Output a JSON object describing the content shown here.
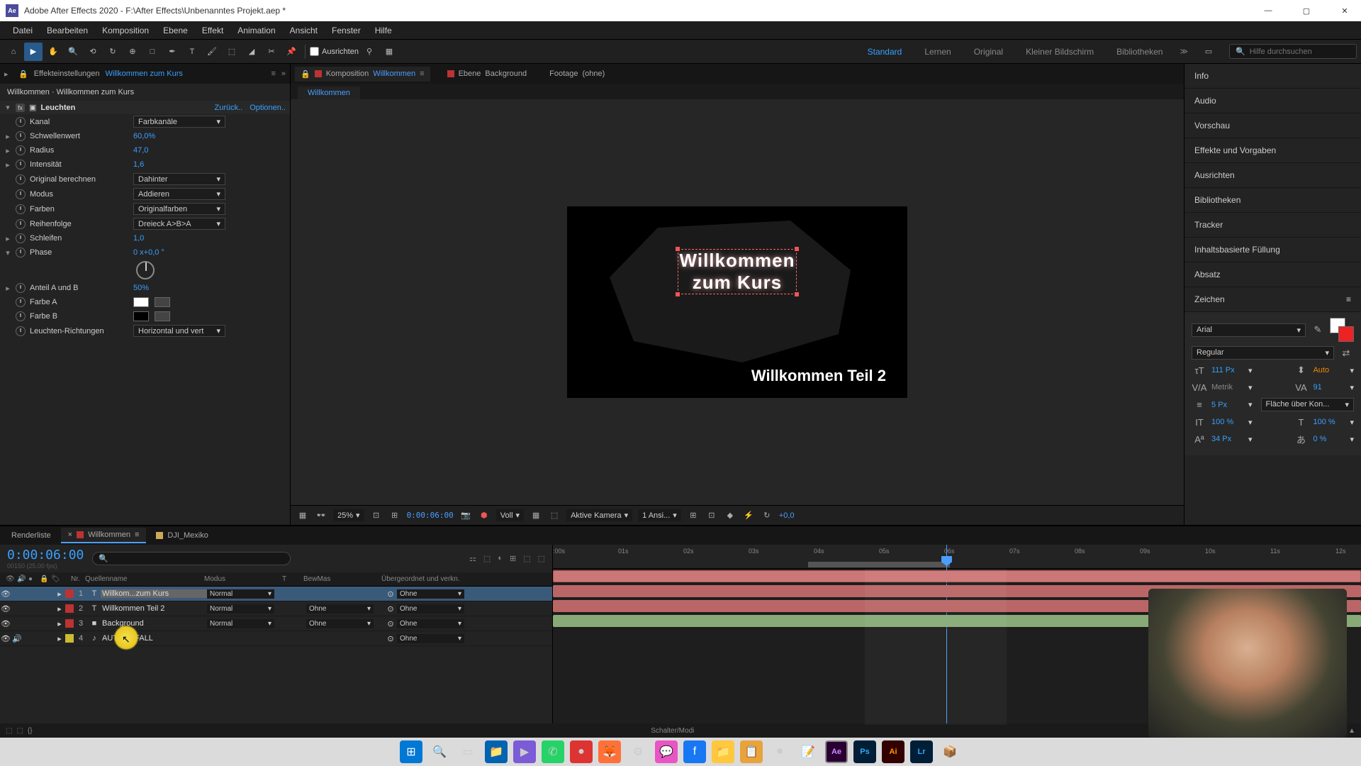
{
  "title": "Adobe After Effects 2020 - F:\\After Effects\\Unbenanntes Projekt.aep *",
  "menu": [
    "Datei",
    "Bearbeiten",
    "Komposition",
    "Ebene",
    "Effekt",
    "Animation",
    "Ansicht",
    "Fenster",
    "Hilfe"
  ],
  "toolbar": {
    "ausrichten": "Ausrichten"
  },
  "workspaces": {
    "standard": "Standard",
    "lernen": "Lernen",
    "original": "Original",
    "kleiner": "Kleiner Bildschirm",
    "bibliotheken": "Bibliotheken"
  },
  "search_placeholder": "Hilfe durchsuchen",
  "effect_panel": {
    "tab_label": "Effekteinstellungen",
    "tab_layer": "Willkommen zum Kurs",
    "breadcrumb": "Willkommen · Willkommen zum Kurs",
    "effect_name": "Leuchten",
    "zurueck": "Zurück..",
    "optionen": "Optionen..",
    "props": {
      "kanal": {
        "label": "Kanal",
        "value": "Farbkanäle"
      },
      "schwelle": {
        "label": "Schwellenwert",
        "value": "60,0%"
      },
      "radius": {
        "label": "Radius",
        "value": "47,0"
      },
      "intensitaet": {
        "label": "Intensität",
        "value": "1,6"
      },
      "original": {
        "label": "Original berechnen",
        "value": "Dahinter"
      },
      "modus": {
        "label": "Modus",
        "value": "Addieren"
      },
      "farben": {
        "label": "Farben",
        "value": "Originalfarben"
      },
      "reihenfolge": {
        "label": "Reihenfolge",
        "value": "Dreieck A>B>A"
      },
      "schleifen": {
        "label": "Schleifen",
        "value": "1,0"
      },
      "phase": {
        "label": "Phase",
        "value": "0 x+0,0 °"
      },
      "anteil": {
        "label": "Anteil A und B",
        "value": "50%"
      },
      "farbeA": {
        "label": "Farbe A"
      },
      "farbeB": {
        "label": "Farbe B"
      },
      "richtungen": {
        "label": "Leuchten-Richtungen",
        "value": "Horizontal und vert"
      }
    }
  },
  "comp_tabs": {
    "komposition": "Komposition",
    "willkommen": "Willkommen",
    "ebene": "Ebene",
    "background": "Background",
    "footage": "Footage",
    "none": "(ohne)"
  },
  "flow_tab": "Willkommen",
  "canvas_text": {
    "line1": "Willkommen",
    "line2": "zum Kurs",
    "subtitle": "Willkommen Teil 2"
  },
  "comp_footer": {
    "zoom": "25%",
    "time": "0:00:06:00",
    "voll": "Voll",
    "kamera": "Aktive Kamera",
    "ansicht": "1 Ansi...",
    "exposure": "+0,0"
  },
  "right_panels": [
    "Info",
    "Audio",
    "Vorschau",
    "Effekte und Vorgaben",
    "Ausrichten",
    "Bibliotheken",
    "Tracker",
    "Inhaltsbasierte Füllung",
    "Absatz"
  ],
  "char_panel": {
    "title": "Zeichen",
    "font": "Arial",
    "weight": "Regular",
    "size": "111 Px",
    "leading": "Auto",
    "kerning": "Metrik",
    "tracking": "91",
    "stroke": "5 Px",
    "fill_opt": "Fläche über Kon...",
    "hscale": "100 %",
    "vscale": "100 %",
    "baseline": "34 Px",
    "tsume": "0 %"
  },
  "timeline": {
    "tabs": {
      "render": "Renderliste",
      "willkommen": "Willkommen",
      "dji": "DJI_Mexiko"
    },
    "timecode": "0:00:06:00",
    "fps": "00150 (25.00 fps)",
    "headers": {
      "nr": "Nr.",
      "quelle": "Quellenname",
      "modus": "Modus",
      "t": "T",
      "bewmas": "BewMas",
      "ueber": "Übergeordnet und verkn."
    },
    "layers": [
      {
        "n": "1",
        "type": "T",
        "name": "Willkom...zum Kurs",
        "mode": "Normal",
        "bewmas": "",
        "parent": "Ohne",
        "color": "#b33",
        "selected": true
      },
      {
        "n": "2",
        "type": "T",
        "name": "Willkommen Teil 2",
        "mode": "Normal",
        "bewmas": "Ohne",
        "parent": "Ohne",
        "color": "#b33",
        "selected": false
      },
      {
        "n": "3",
        "type": "■",
        "name": "Background",
        "mode": "Normal",
        "bewmas": "Ohne",
        "parent": "Ohne",
        "color": "#b33",
        "selected": false
      },
      {
        "n": "4",
        "type": "♪",
        "name": "AUTOUNFALL",
        "mode": "",
        "bewmas": "",
        "parent": "Ohne",
        "color": "#cb3",
        "selected": false
      }
    ],
    "ticks": [
      ":00s",
      "01s",
      "02s",
      "03s",
      "04s",
      "05s",
      "06s",
      "07s",
      "08s",
      "09s",
      "10s",
      "11s",
      "12s"
    ],
    "schalter": "Schalter/Modi"
  }
}
